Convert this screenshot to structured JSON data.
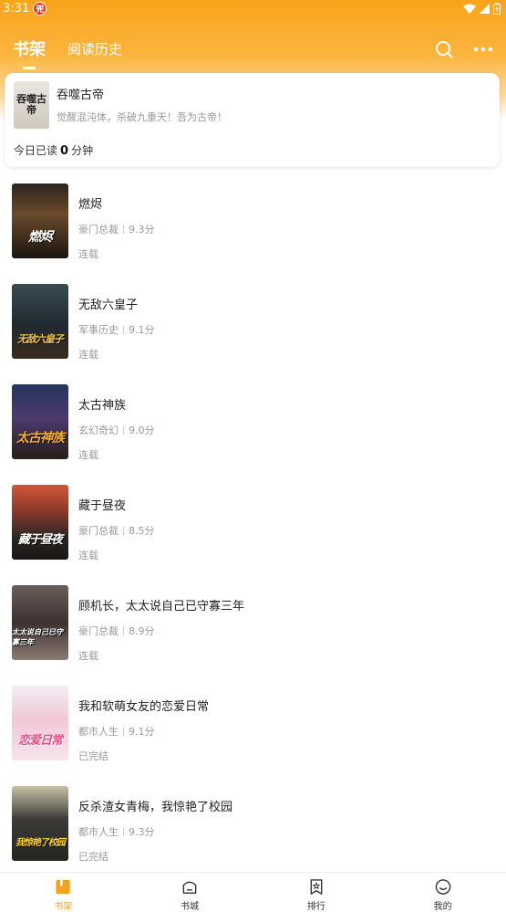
{
  "status_bar": {
    "time": "3:31",
    "notif_glyph": "兜"
  },
  "header": {
    "tabs": [
      {
        "label": "书架",
        "active": true
      },
      {
        "label": "阅读历史",
        "active": false
      }
    ],
    "icons": [
      "search-icon",
      "more-icon"
    ]
  },
  "reading_card": {
    "title": "吞噬古帝",
    "description": "觉醒混沌体，杀破九重天！吾为古帝！",
    "cover_text": "吞噬古帝",
    "today_prefix": "今日已读",
    "today_minutes": "0",
    "today_suffix": "分钟"
  },
  "books": [
    {
      "title": "燃烬",
      "category": "豪门总裁",
      "score": "9.3分",
      "status": "连载",
      "cover_text": "燃烬"
    },
    {
      "title": "无敌六皇子",
      "category": "军事历史",
      "score": "9.1分",
      "status": "连载",
      "cover_text": "无敌六皇子"
    },
    {
      "title": "太古神族",
      "category": "玄幻奇幻",
      "score": "9.0分",
      "status": "连载",
      "cover_text": "太古神族"
    },
    {
      "title": "藏于昼夜",
      "category": "豪门总裁",
      "score": "8.5分",
      "status": "连载",
      "cover_text": "藏于昼夜"
    },
    {
      "title": "顾机长，太太说自己已守寡三年",
      "category": "豪门总裁",
      "score": "8.9分",
      "status": "连载",
      "cover_text": "太太说自己已守寡三年"
    },
    {
      "title": "我和软萌女友的恋爱日常",
      "category": "都市人生",
      "score": "9.1分",
      "status": "已完结",
      "cover_text": "恋爱日常"
    },
    {
      "title": "反杀渣女青梅，我惊艳了校园",
      "category": "都市人生",
      "score": "9.3分",
      "status": "已完结",
      "cover_text": "我惊艳了校园"
    }
  ],
  "bottom_nav": [
    {
      "label": "书架",
      "icon": "bookshelf-icon",
      "active": true
    },
    {
      "label": "书城",
      "icon": "bookstore-icon",
      "active": false
    },
    {
      "label": "排行",
      "icon": "ranking-icon",
      "active": false
    },
    {
      "label": "我的",
      "icon": "profile-icon",
      "active": false
    }
  ],
  "colors": {
    "accent": "#f4a21c",
    "header_top": "#f9a41a"
  }
}
